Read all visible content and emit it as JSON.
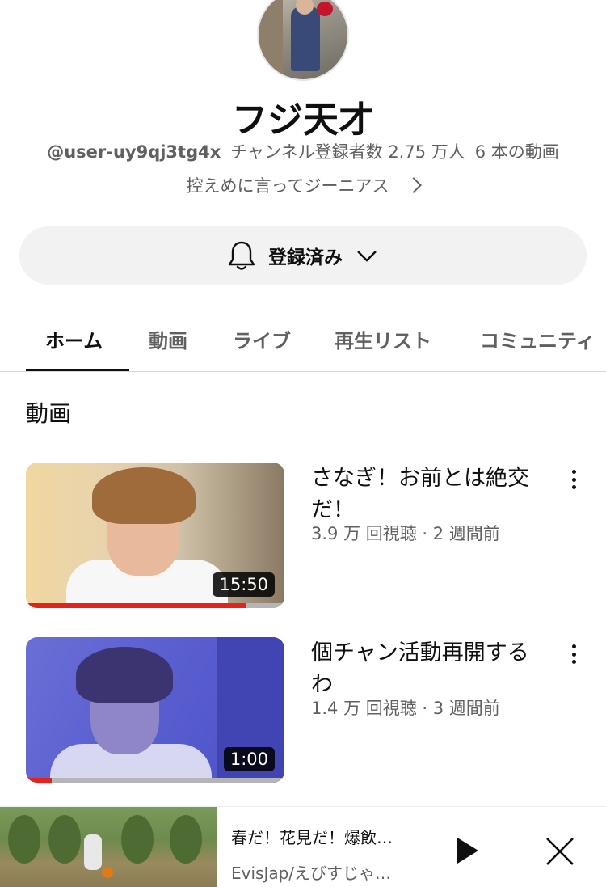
{
  "channel": {
    "name": "フジ天才",
    "handle": "@user-uy9qj3tg4x",
    "subscribers": "チャンネル登録者数 2.75 万人",
    "video_count": "6 本の動画",
    "description": "控えめに言ってジーニアス"
  },
  "subscribe": {
    "label": "登録済み"
  },
  "tabs": [
    {
      "label": "ホーム",
      "active": true
    },
    {
      "label": "動画",
      "active": false
    },
    {
      "label": "ライブ",
      "active": false
    },
    {
      "label": "再生リスト",
      "active": false
    },
    {
      "label": "コミュニティ",
      "active": false
    }
  ],
  "section": {
    "title": "動画"
  },
  "videos": [
    {
      "title": "さなぎ！お前とは絶交だ！",
      "views": "3.9万 回視聴",
      "age": "2 週間前",
      "meta": "3.9 万 回視聴 · 2 週間前",
      "duration": "15:50",
      "watched_fraction": 0.85
    },
    {
      "title": "個チャン活動再開するわ",
      "views": "1.4 万 回視聴",
      "age": "3 週間前",
      "meta": "1.4 万 回視聴 · 3 週間前",
      "duration": "1:00",
      "watched_fraction": 0.1
    }
  ],
  "miniplayer": {
    "title": "春だ！花見だ！爆飲…",
    "channel": "EvisJap/えびすじゃ…"
  }
}
